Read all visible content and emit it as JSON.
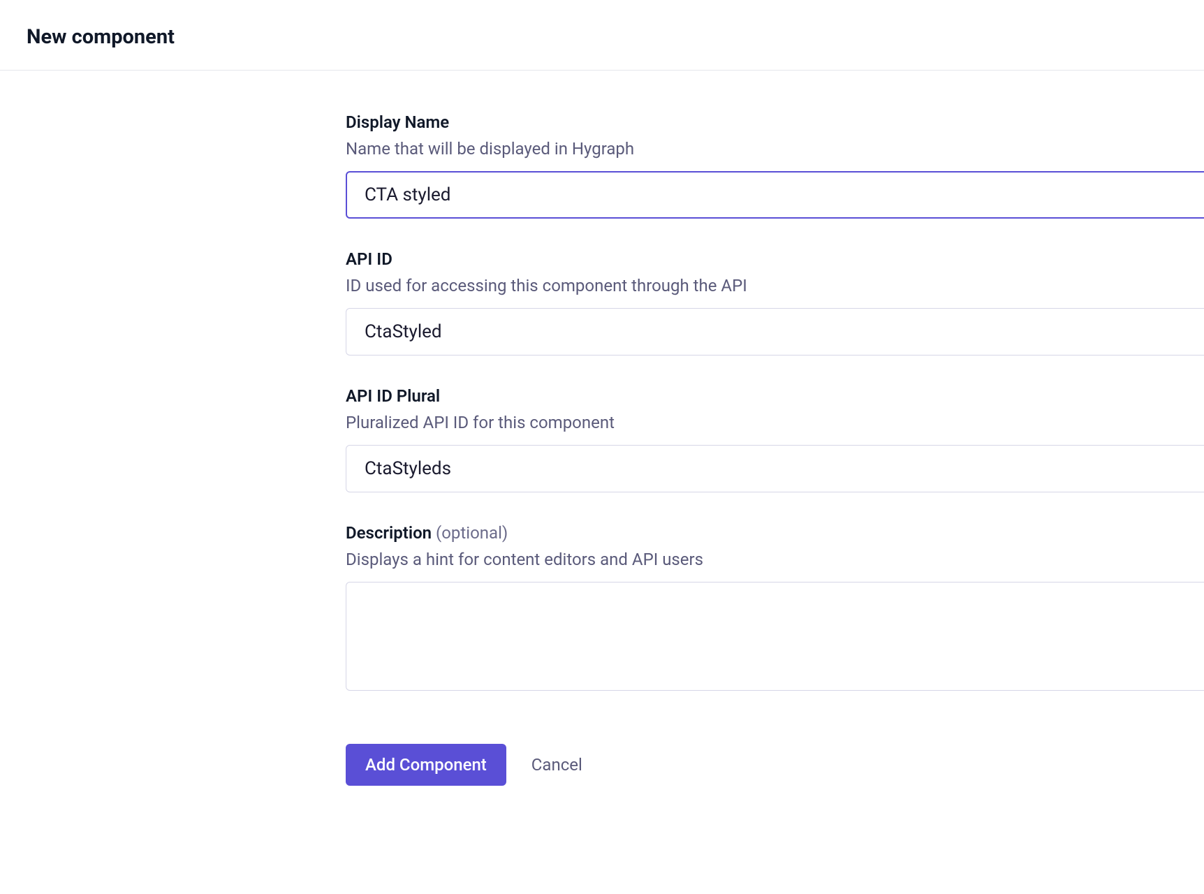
{
  "header": {
    "title": "New component"
  },
  "fields": {
    "displayName": {
      "label": "Display Name",
      "hint": "Name that will be displayed in Hygraph",
      "value": "CTA styled"
    },
    "apiId": {
      "label": "API ID",
      "hint": "ID used for accessing this component through the API",
      "value": "CtaStyled"
    },
    "apiIdPlural": {
      "label": "API ID Plural",
      "hint": "Pluralized API ID for this component",
      "value": "CtaStyleds"
    },
    "description": {
      "label": "Description",
      "optional": "(optional)",
      "hint": "Displays a hint for content editors and API users",
      "value": ""
    }
  },
  "buttons": {
    "submit": "Add Component",
    "cancel": "Cancel"
  }
}
